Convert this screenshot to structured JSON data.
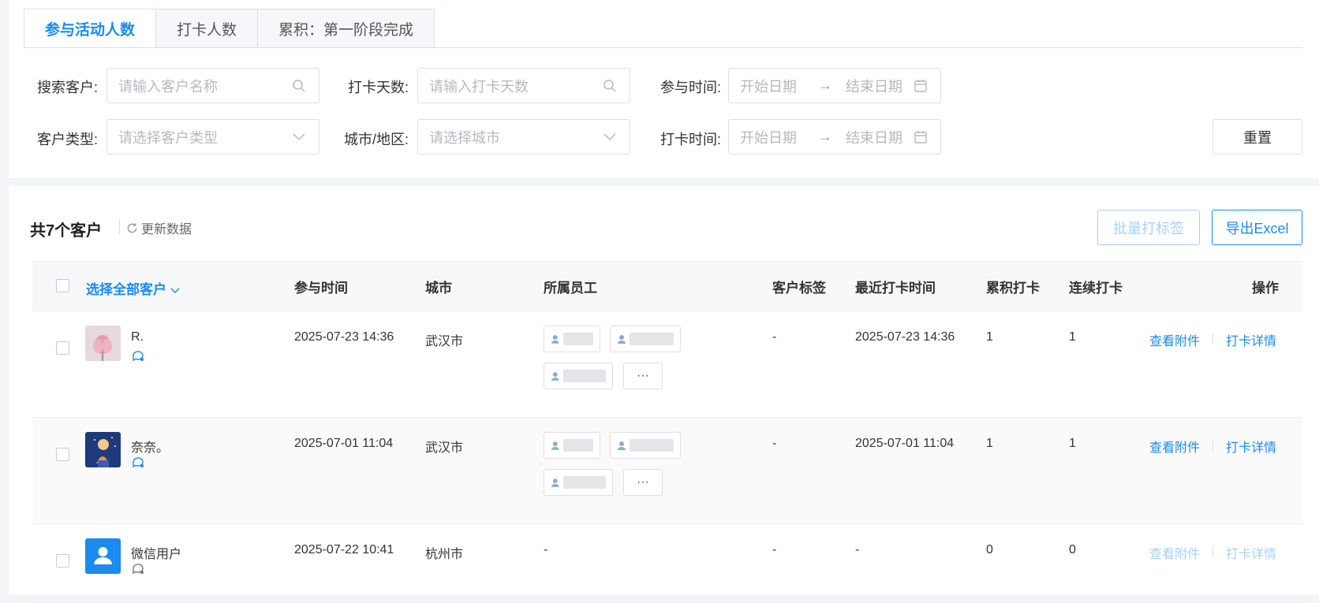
{
  "tabs": [
    "参与活动人数",
    "打卡人数",
    "累积：第一阶段完成"
  ],
  "filters": {
    "search_label": "搜索客户:",
    "search_placeholder": "请输入客户名称",
    "days_label": "打卡天数:",
    "days_placeholder": "请输入打卡天数",
    "join_time_label": "参与时间:",
    "type_label": "客户类型:",
    "type_placeholder": "请选择客户类型",
    "city_label": "城市/地区:",
    "city_placeholder": "请选择城市",
    "checkin_time_label": "打卡时间:",
    "start_placeholder": "开始日期",
    "end_placeholder": "结束日期",
    "range_arrow": "→",
    "reset_label": "重置"
  },
  "summary": {
    "count_text": "共7个客户",
    "refresh_label": "更新数据",
    "batch_tag_label": "批量打标签",
    "export_label": "导出Excel"
  },
  "table": {
    "headers": {
      "select_all": "选择全部客户",
      "join_time": "参与时间",
      "city": "城市",
      "staff": "所属员工",
      "tags": "客户标签",
      "last_checkin": "最近打卡时间",
      "total_checkin": "累积打卡",
      "streak": "连续打卡",
      "actions": "操作"
    },
    "rows": [
      {
        "name": "R.",
        "join_time": "2025-07-23 14:36",
        "city": "武汉市",
        "tags": "-",
        "last_checkin": "2025-07-23 14:36",
        "total": "1",
        "streak": "1",
        "more": "···"
      },
      {
        "name": "奈奈。",
        "join_time": "2025-07-01 11:04",
        "city": "武汉市",
        "tags": "-",
        "last_checkin": "2025-07-01 11:04",
        "total": "1",
        "streak": "1",
        "more": "···"
      },
      {
        "name": "微信用户",
        "join_time": "2025-07-22 10:41",
        "city": "杭州市",
        "staff": "-",
        "tags": "-",
        "last_checkin": "-",
        "total": "0",
        "streak": "0"
      }
    ],
    "action_view": "查看附件",
    "action_detail": "打卡详情"
  },
  "colors": {
    "accent": "#1a8bf0",
    "disabled": "#a7d2f7"
  }
}
